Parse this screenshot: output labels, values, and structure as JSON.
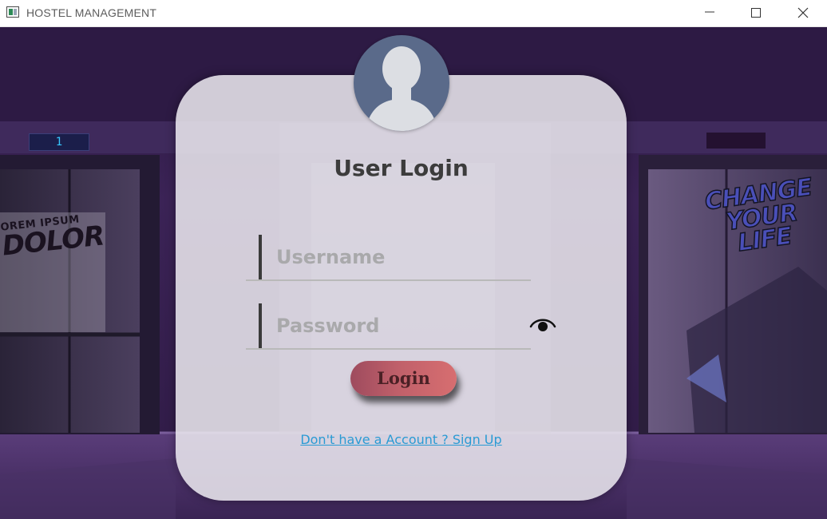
{
  "window": {
    "title": "HOSTEL MANAGEMENT",
    "icon": "app-window-icon",
    "controls": [
      "minimize-icon",
      "maximize-icon",
      "close-icon"
    ]
  },
  "background": {
    "elevator_left_floor": "1",
    "graffiti_left": [
      "OREM IPSUM",
      "DOLOR"
    ],
    "graffiti_right": [
      "CHANGE",
      "YOUR",
      "LIFE"
    ]
  },
  "login": {
    "avatar_icon": "user-avatar-icon",
    "title": "User Login",
    "username_placeholder": "Username",
    "username_value": "",
    "password_placeholder": "Password",
    "password_value": "",
    "show_password_icon": "eye-icon",
    "login_button": "Login",
    "signup_link": "Don't have a Account ? Sign Up"
  },
  "colors": {
    "card": "#ECEAF0",
    "button_start": "#9E4B5E",
    "button_end": "#D76E70",
    "link": "#2A9BD4",
    "background": "#3A2550"
  }
}
